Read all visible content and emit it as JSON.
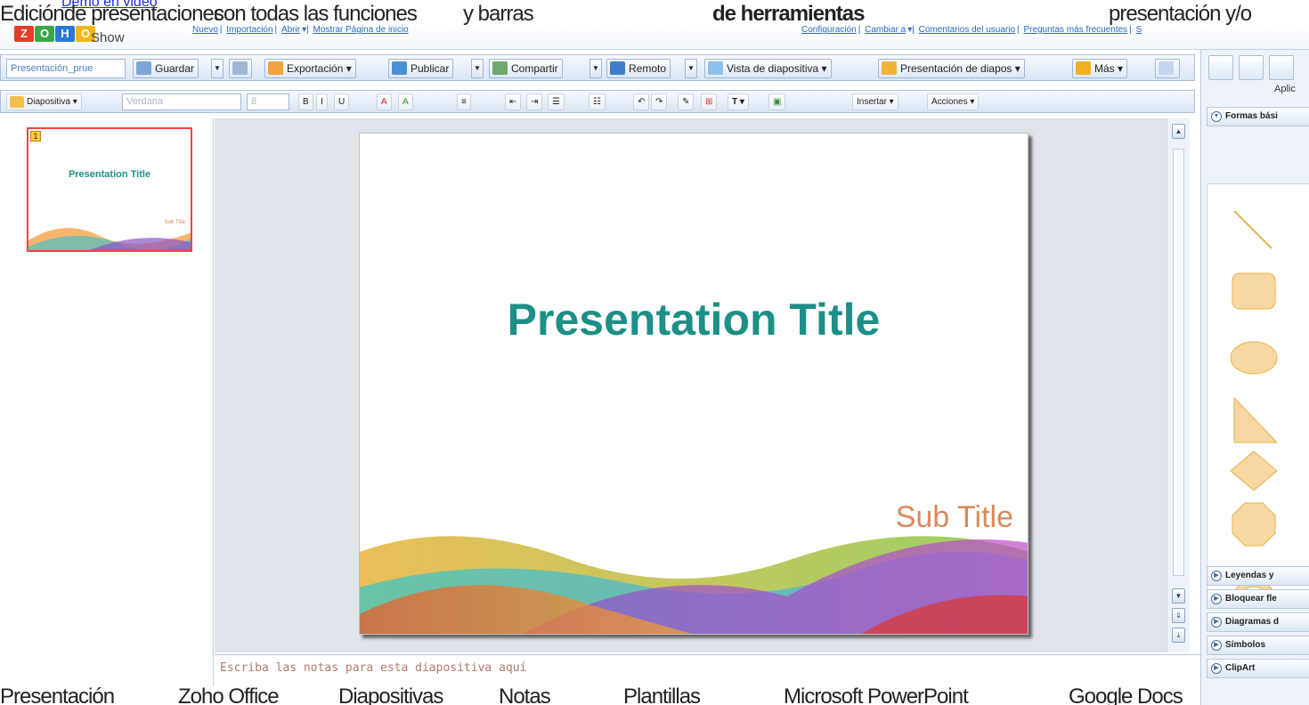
{
  "overlay": {
    "demo_link": "Demo en video",
    "top_fragments": [
      "Ediciónde presentaciones",
      "con todas las funciones",
      "y barras",
      "de herramientas",
      "presentación y/o"
    ],
    "bottom_fragments": [
      "Presentación",
      "Zoho Office",
      "Diapositivas",
      "Notas",
      "Plantillas",
      "Microsoft PowerPoint",
      "Google Docs"
    ]
  },
  "header": {
    "logo_letters": [
      "Z",
      "O",
      "H",
      "O"
    ],
    "product": "Show",
    "links_left": [
      "Nuevo",
      "Importación",
      "Abrir",
      "Mostrar Página de inicio"
    ],
    "links_right": [
      "Configuración",
      "Cambiar a",
      "Comentarios del usuario",
      "Preguntas más frecuentes",
      "S"
    ]
  },
  "toolbar1": {
    "doc_name": "Presentación_prue",
    "save": "Guardar",
    "export": "Exportación",
    "publish": "Publicar",
    "share": "Compartir",
    "remote": "Remoto",
    "slide_view": "Vista de diapositiva",
    "slideshow": "Presentación de diapos",
    "more": "Más"
  },
  "toolbar2": {
    "slide_menu": "Diapositiva",
    "font": "Verdana",
    "size": "8",
    "insert": "Insertar",
    "actions": "Acciones"
  },
  "right_panel": {
    "header": "Aplic",
    "sections": [
      "Formas bási",
      "Leyendas y",
      "Bloquear fle",
      "Diagramas d",
      "Símbolos",
      "ClipArt"
    ]
  },
  "slide": {
    "title": "Presentation Title",
    "subtitle": "Sub Title",
    "number": "1"
  },
  "notes": {
    "placeholder": "Escriba las notas para esta diapositiva aquí"
  },
  "colors": {
    "title": "#1c8f87",
    "subtitle": "#d98a5a",
    "selection": "#ee4444"
  }
}
